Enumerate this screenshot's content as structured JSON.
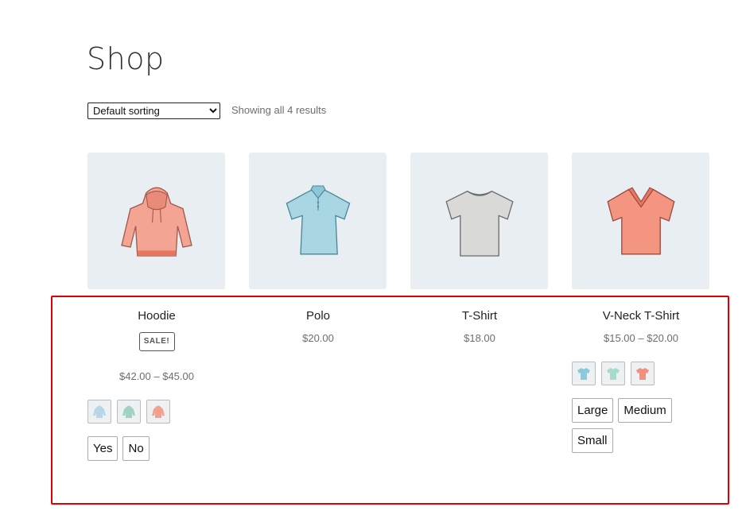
{
  "page": {
    "title": "Shop"
  },
  "toolbar": {
    "sort_selected": "Default sorting",
    "result_count": "Showing all 4 results"
  },
  "products": [
    {
      "name": "Hoodie",
      "badge": "SALE!",
      "price": "$42.00 – $45.00",
      "image_icon": "hoodie-icon",
      "image_color": "#f4a493",
      "swatches": [
        {
          "icon": "hoodie-blue-swatch-icon",
          "color": "#b7d6e6"
        },
        {
          "icon": "hoodie-green-swatch-icon",
          "color": "#9fd2c4"
        },
        {
          "icon": "hoodie-red-swatch-icon",
          "color": "#f2a08f"
        }
      ],
      "options": [
        "Yes",
        "No"
      ]
    },
    {
      "name": "Polo",
      "price": "$20.00",
      "image_icon": "polo-shirt-icon",
      "image_color": "#a8d6e2"
    },
    {
      "name": "T-Shirt",
      "price": "$18.00",
      "image_icon": "t-shirt-icon",
      "image_color": "#d9d9d7"
    },
    {
      "name": "V-Neck T-Shirt",
      "price": "$15.00 – $20.00",
      "image_icon": "v-neck-t-shirt-icon",
      "image_color": "#f39580",
      "swatches": [
        {
          "icon": "tshirt-blue-swatch-icon",
          "color": "#8cc9dc"
        },
        {
          "icon": "tshirt-green-swatch-icon",
          "color": "#a6dbc9"
        },
        {
          "icon": "tshirt-red-swatch-icon",
          "color": "#f2907e"
        }
      ],
      "options": [
        "Large",
        "Medium",
        "Small"
      ]
    }
  ],
  "annotation": {
    "highlight_color": "#e00000"
  }
}
